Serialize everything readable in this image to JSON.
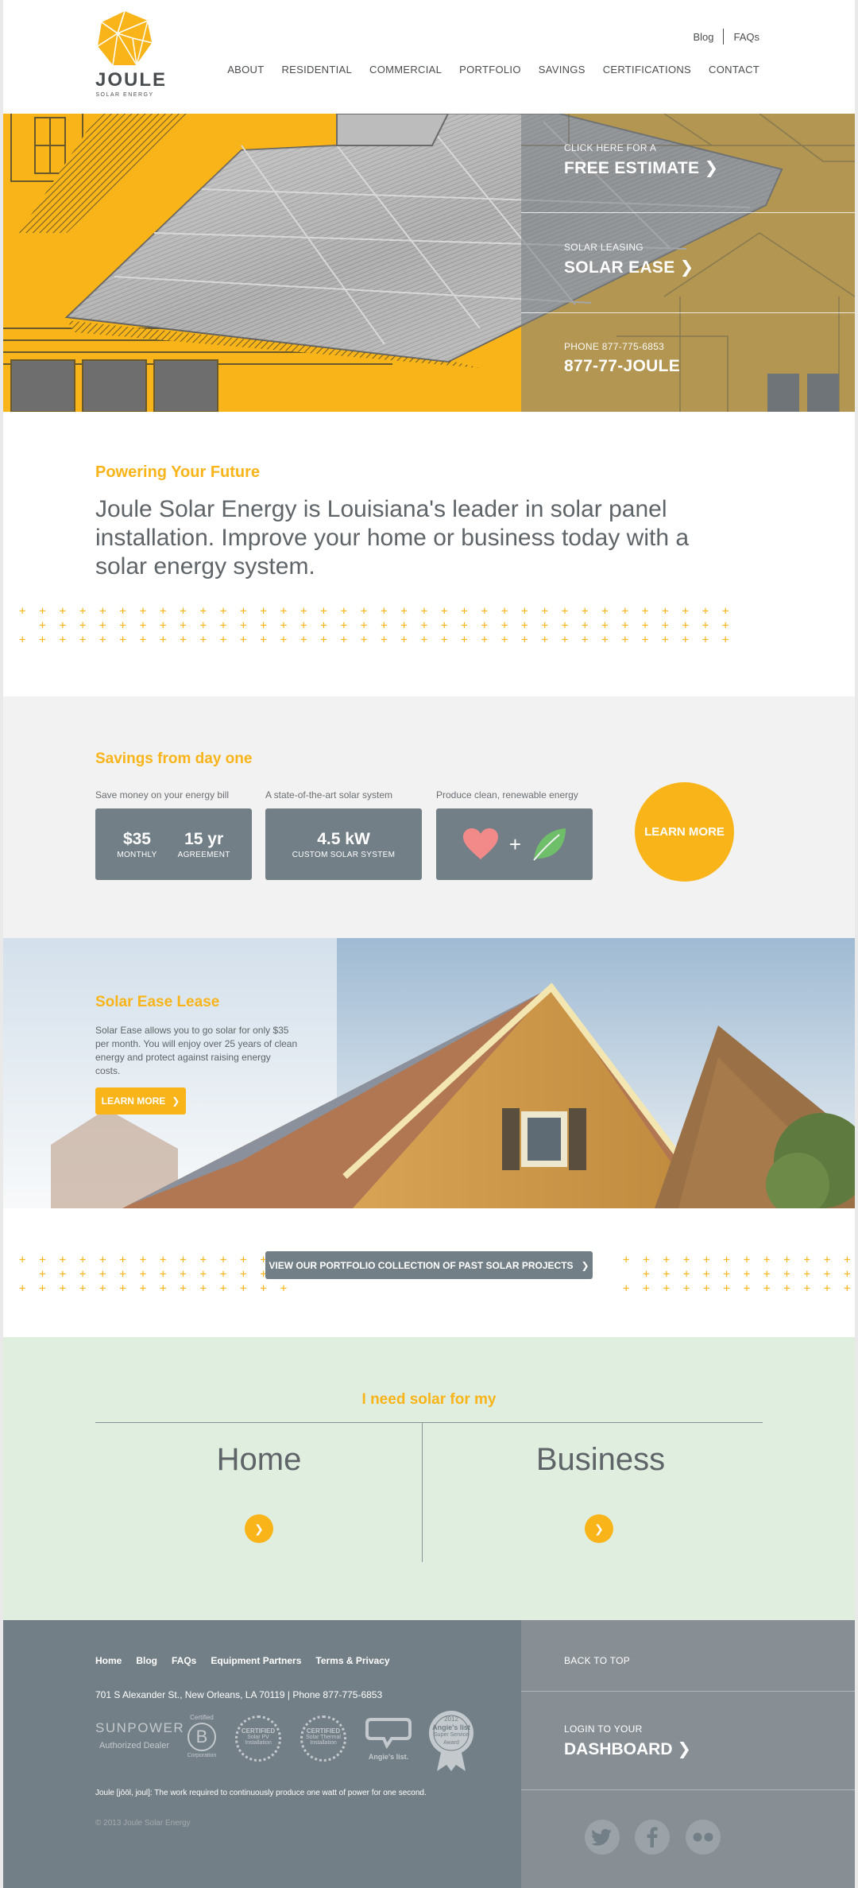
{
  "header": {
    "logo": {
      "word": "JOULE",
      "sub": "SOLAR ENERGY"
    },
    "top_links": [
      "Blog",
      "FAQs"
    ],
    "nav": [
      "ABOUT",
      "RESIDENTIAL",
      "COMMERCIAL",
      "PORTFOLIO",
      "SAVINGS",
      "CERTIFICATIONS",
      "CONTACT"
    ]
  },
  "hero": {
    "items": [
      {
        "small": "CLICK HERE FOR A",
        "big": "FREE ESTIMATE"
      },
      {
        "small": "SOLAR LEASING",
        "big": "SOLAR EASE"
      },
      {
        "small": "PHONE 877-775-6853",
        "big": "877-77-JOULE"
      }
    ]
  },
  "intro": {
    "kicker": "Powering Your Future",
    "text": "Joule Solar Energy is Louisiana's leader in solar panel installation. Improve your home or business today with a solar energy system."
  },
  "savings": {
    "title": "Savings from day one",
    "col1": {
      "caption": "Save money on your energy bill",
      "stat_a": {
        "value": "$35",
        "unit": "MONTHLY"
      },
      "stat_b": {
        "value": "15 yr",
        "unit": "AGREEMENT"
      }
    },
    "col2": {
      "caption": "A state-of-the-art solar system",
      "stat": {
        "value": "4.5 kW",
        "unit": "CUSTOM SOLAR SYSTEM"
      }
    },
    "col3": {
      "caption": "Produce clean, renewable energy",
      "plus": "+"
    },
    "learn_more": "LEARN MORE"
  },
  "lease": {
    "title": "Solar Ease Lease",
    "text": "Solar Ease allows you to go solar for only $35 per month. You will enjoy over 25 years of clean energy and protect against raising energy costs.",
    "button": "LEARN MORE"
  },
  "portfolio": {
    "button": "VIEW OUR PORTFOLIO COLLECTION OF PAST SOLAR PROJECTS"
  },
  "need": {
    "title": "I need solar for my",
    "home": "Home",
    "business": "Business"
  },
  "footer": {
    "links": [
      "Home",
      "Blog",
      "FAQs",
      "Equipment Partners",
      "Terms & Privacy"
    ],
    "address": "701 S Alexander St., New Orleans, LA 70119 | Phone 877-775-6853",
    "badges": {
      "sunpower": "SUNPOWER",
      "sunpower_sub": "Authorized Dealer",
      "bcorp_top": "Certified",
      "bcorp_letter": "B",
      "bcorp_bottom": "Corporation",
      "nabcep1_a": "CERTIFIED",
      "nabcep1_b": "Solar PV",
      "nabcep1_c": "Installation",
      "nabcep2_a": "CERTIFIED",
      "nabcep2_b": "Solar Thermal",
      "nabcep2_c": "Installation",
      "angies": "Angie's list.",
      "award_year": "2012",
      "award_name": "Angie's list",
      "award_line1": "Super Service",
      "award_line2": "Award"
    },
    "definition": "Joule [jōōl, joul]: The work required to continuously produce one watt of power for one second.",
    "copyright": "© 2013 Joule Solar Energy",
    "right": {
      "back_to_top": "BACK TO TOP",
      "login_small": "LOGIN TO YOUR",
      "login_big": "DASHBOARD"
    },
    "social_icons": [
      "twitter-icon",
      "facebook-icon",
      "flickr-icon"
    ]
  },
  "colors": {
    "accent": "#f8b418",
    "slate": "#737f86",
    "mint": "#e0eee0",
    "text": "#5f6468"
  }
}
